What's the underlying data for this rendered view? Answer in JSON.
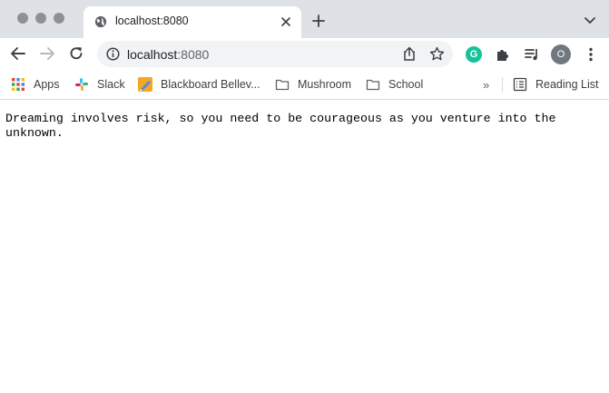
{
  "tab": {
    "title": "localhost:8080"
  },
  "omnibox": {
    "host": "localhost",
    "port": ":8080"
  },
  "profile": {
    "initial": "O"
  },
  "bookmarks": {
    "items": [
      {
        "label": "Apps",
        "icon": "apps-grid-icon"
      },
      {
        "label": "Slack",
        "icon": "slack-icon"
      },
      {
        "label": "Blackboard Bellev...",
        "icon": "blackboard-icon"
      },
      {
        "label": "Mushroom",
        "icon": "folder-icon"
      },
      {
        "label": "School",
        "icon": "folder-icon"
      }
    ],
    "more": "»",
    "reading_list": "Reading List"
  },
  "page": {
    "text": "Dreaming involves risk, so you need to be courageous as you venture into the unknown."
  },
  "colors": {
    "tab_strip": "#dee1e6",
    "omnibox_bg": "#f1f3f4",
    "grammarly": "#15c39a",
    "profile": "#6f7780"
  }
}
